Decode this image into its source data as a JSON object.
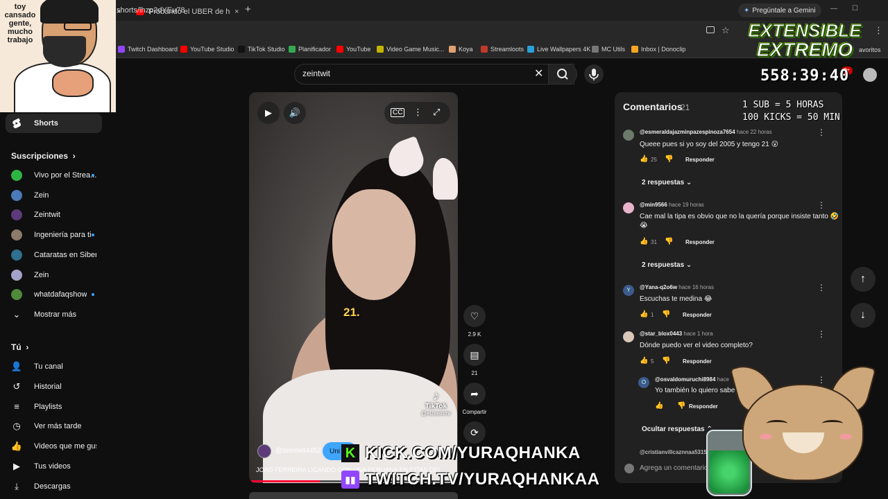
{
  "browser": {
    "active_tab_title": "Probando el UBER de helicópte",
    "tab_close": "×",
    "new_tab": "+",
    "gemini_label": "Pregúntale a Gemini",
    "url": "shorts/lhzp2dYEu78",
    "bookmarks": [
      {
        "label": "Twitch Dashboard",
        "color": "#9146ff"
      },
      {
        "label": "YouTube Studio",
        "color": "#ff0000"
      },
      {
        "label": "TikTok Studio",
        "color": "#111111"
      },
      {
        "label": "Planificador",
        "color": "#34a853"
      },
      {
        "label": "YouTube",
        "color": "#ff0000"
      },
      {
        "label": "Video Game Music...",
        "color": "#c2b400"
      },
      {
        "label": "Koya",
        "color": "#e0a070"
      },
      {
        "label": "Streamloots",
        "color": "#c0392b"
      },
      {
        "label": "Live Wallpapers 4K",
        "color": "#2aa0d8"
      },
      {
        "label": "MC Utils",
        "color": "#777777"
      },
      {
        "label": "Inbox | Donoclip",
        "color": "#f5a623"
      }
    ],
    "favorites_label": "avoritos"
  },
  "search": {
    "query": "zeintwit"
  },
  "sidebar": {
    "shorts_label": "Shorts",
    "subscriptions_header": "Suscripciones",
    "subscriptions": [
      {
        "label": "Vivo por el Strea...",
        "color": "#2fb344",
        "new": true
      },
      {
        "label": "Zein",
        "color": "#4a7ab8",
        "new": false
      },
      {
        "label": "Zeintwit",
        "color": "#5d3b7a",
        "new": false
      },
      {
        "label": "Ingeniería para ti",
        "color": "#8c7a6b",
        "new": true
      },
      {
        "label": "Cataratas en Siberia",
        "color": "#2f6f8f",
        "new": false
      },
      {
        "label": "Zein",
        "color": "#a3a3c9",
        "new": false
      },
      {
        "label": "whatdafaqshow",
        "color": "#4f8a3a",
        "new": true
      }
    ],
    "show_more_label": "Mostrar más",
    "you_header": "Tú",
    "you_items": [
      {
        "label": "Tu canal",
        "icon": "channel-icon"
      },
      {
        "label": "Historial",
        "icon": "history-icon"
      },
      {
        "label": "Playlists",
        "icon": "playlists-icon"
      },
      {
        "label": "Ver más tarde",
        "icon": "watch-later-icon"
      },
      {
        "label": "Videos que me gus...",
        "icon": "liked-icon"
      },
      {
        "label": "Tus videos",
        "icon": "your-videos-icon"
      },
      {
        "label": "Descargas",
        "icon": "downloads-icon"
      }
    ]
  },
  "video": {
    "caption": "21.",
    "watermark_app": "TikTok",
    "watermark_handle": "@elzeeinmr",
    "channel_handle": "@zeintwit4452",
    "subscribe_label": "Uni",
    "title": "JOAO FERREIRA LIGANDO CON UNA PERUANA EN CITAS DEL...",
    "progress": 0.34
  },
  "actions": {
    "likes": "2.9 K",
    "comments": "21",
    "share": "Compartir"
  },
  "comments": {
    "title": "Comentarios",
    "count": "21",
    "items": [
      {
        "author": "@esmeraldajazminpazespinoza7654",
        "time": "hace 22 horas",
        "text": "Queee pues si yo soy del 2005 y tengo 21 😮",
        "likes": "25",
        "reply": "Responder",
        "replies": "2 respuestas",
        "avatar": "#6b7a6b"
      },
      {
        "author": "@min9566",
        "time": "hace 19 horas",
        "text": "Cae mal la tipa es obvio que no la quería porque insiste tanto 🤣",
        "text2": "😭",
        "likes": "31",
        "reply": "Responder",
        "replies": "2 respuestas",
        "avatar": "#e6b3c9"
      },
      {
        "author": "@Yana-q2o6w",
        "time": "hace 16 horas",
        "text": "Escuchas te medina 😂",
        "likes": "1",
        "reply": "Responder",
        "avatar": "#3c5a8c",
        "initial": "Y"
      },
      {
        "author": "@star_blox0443",
        "time": "hace 1 hora",
        "text": "Dónde puedo ver el video completo?",
        "likes": "5",
        "reply": "Responder",
        "avatar": "#d9c7b8"
      },
      {
        "author": "@osvaldomuruchi8984",
        "time": "hace",
        "text": "Yo también lo quiero sabe",
        "reply": "Responder",
        "avatar": "#3c5a8c",
        "initial": "O"
      }
    ],
    "hide_replies": "Ocultar respuestas",
    "next_author": "@cristianvillcaznnaa5315",
    "add_placeholder": "Agrega un comentario"
  },
  "overlay": {
    "webcam_text": "toy cansado gente, mucho trabajo",
    "title_line1": "EXTENSIBLE",
    "title_line2": "EXTREMO",
    "timer": "558:39:40",
    "rule1": "1 SUB = 5 HORAS",
    "rule2": "100 KICKS = 50 MIN",
    "notif": "9+",
    "kick_url": "KICK.COM/YURAQHANKA",
    "twitch_url": "TWITCH.TV/YURAQHANKAA"
  }
}
